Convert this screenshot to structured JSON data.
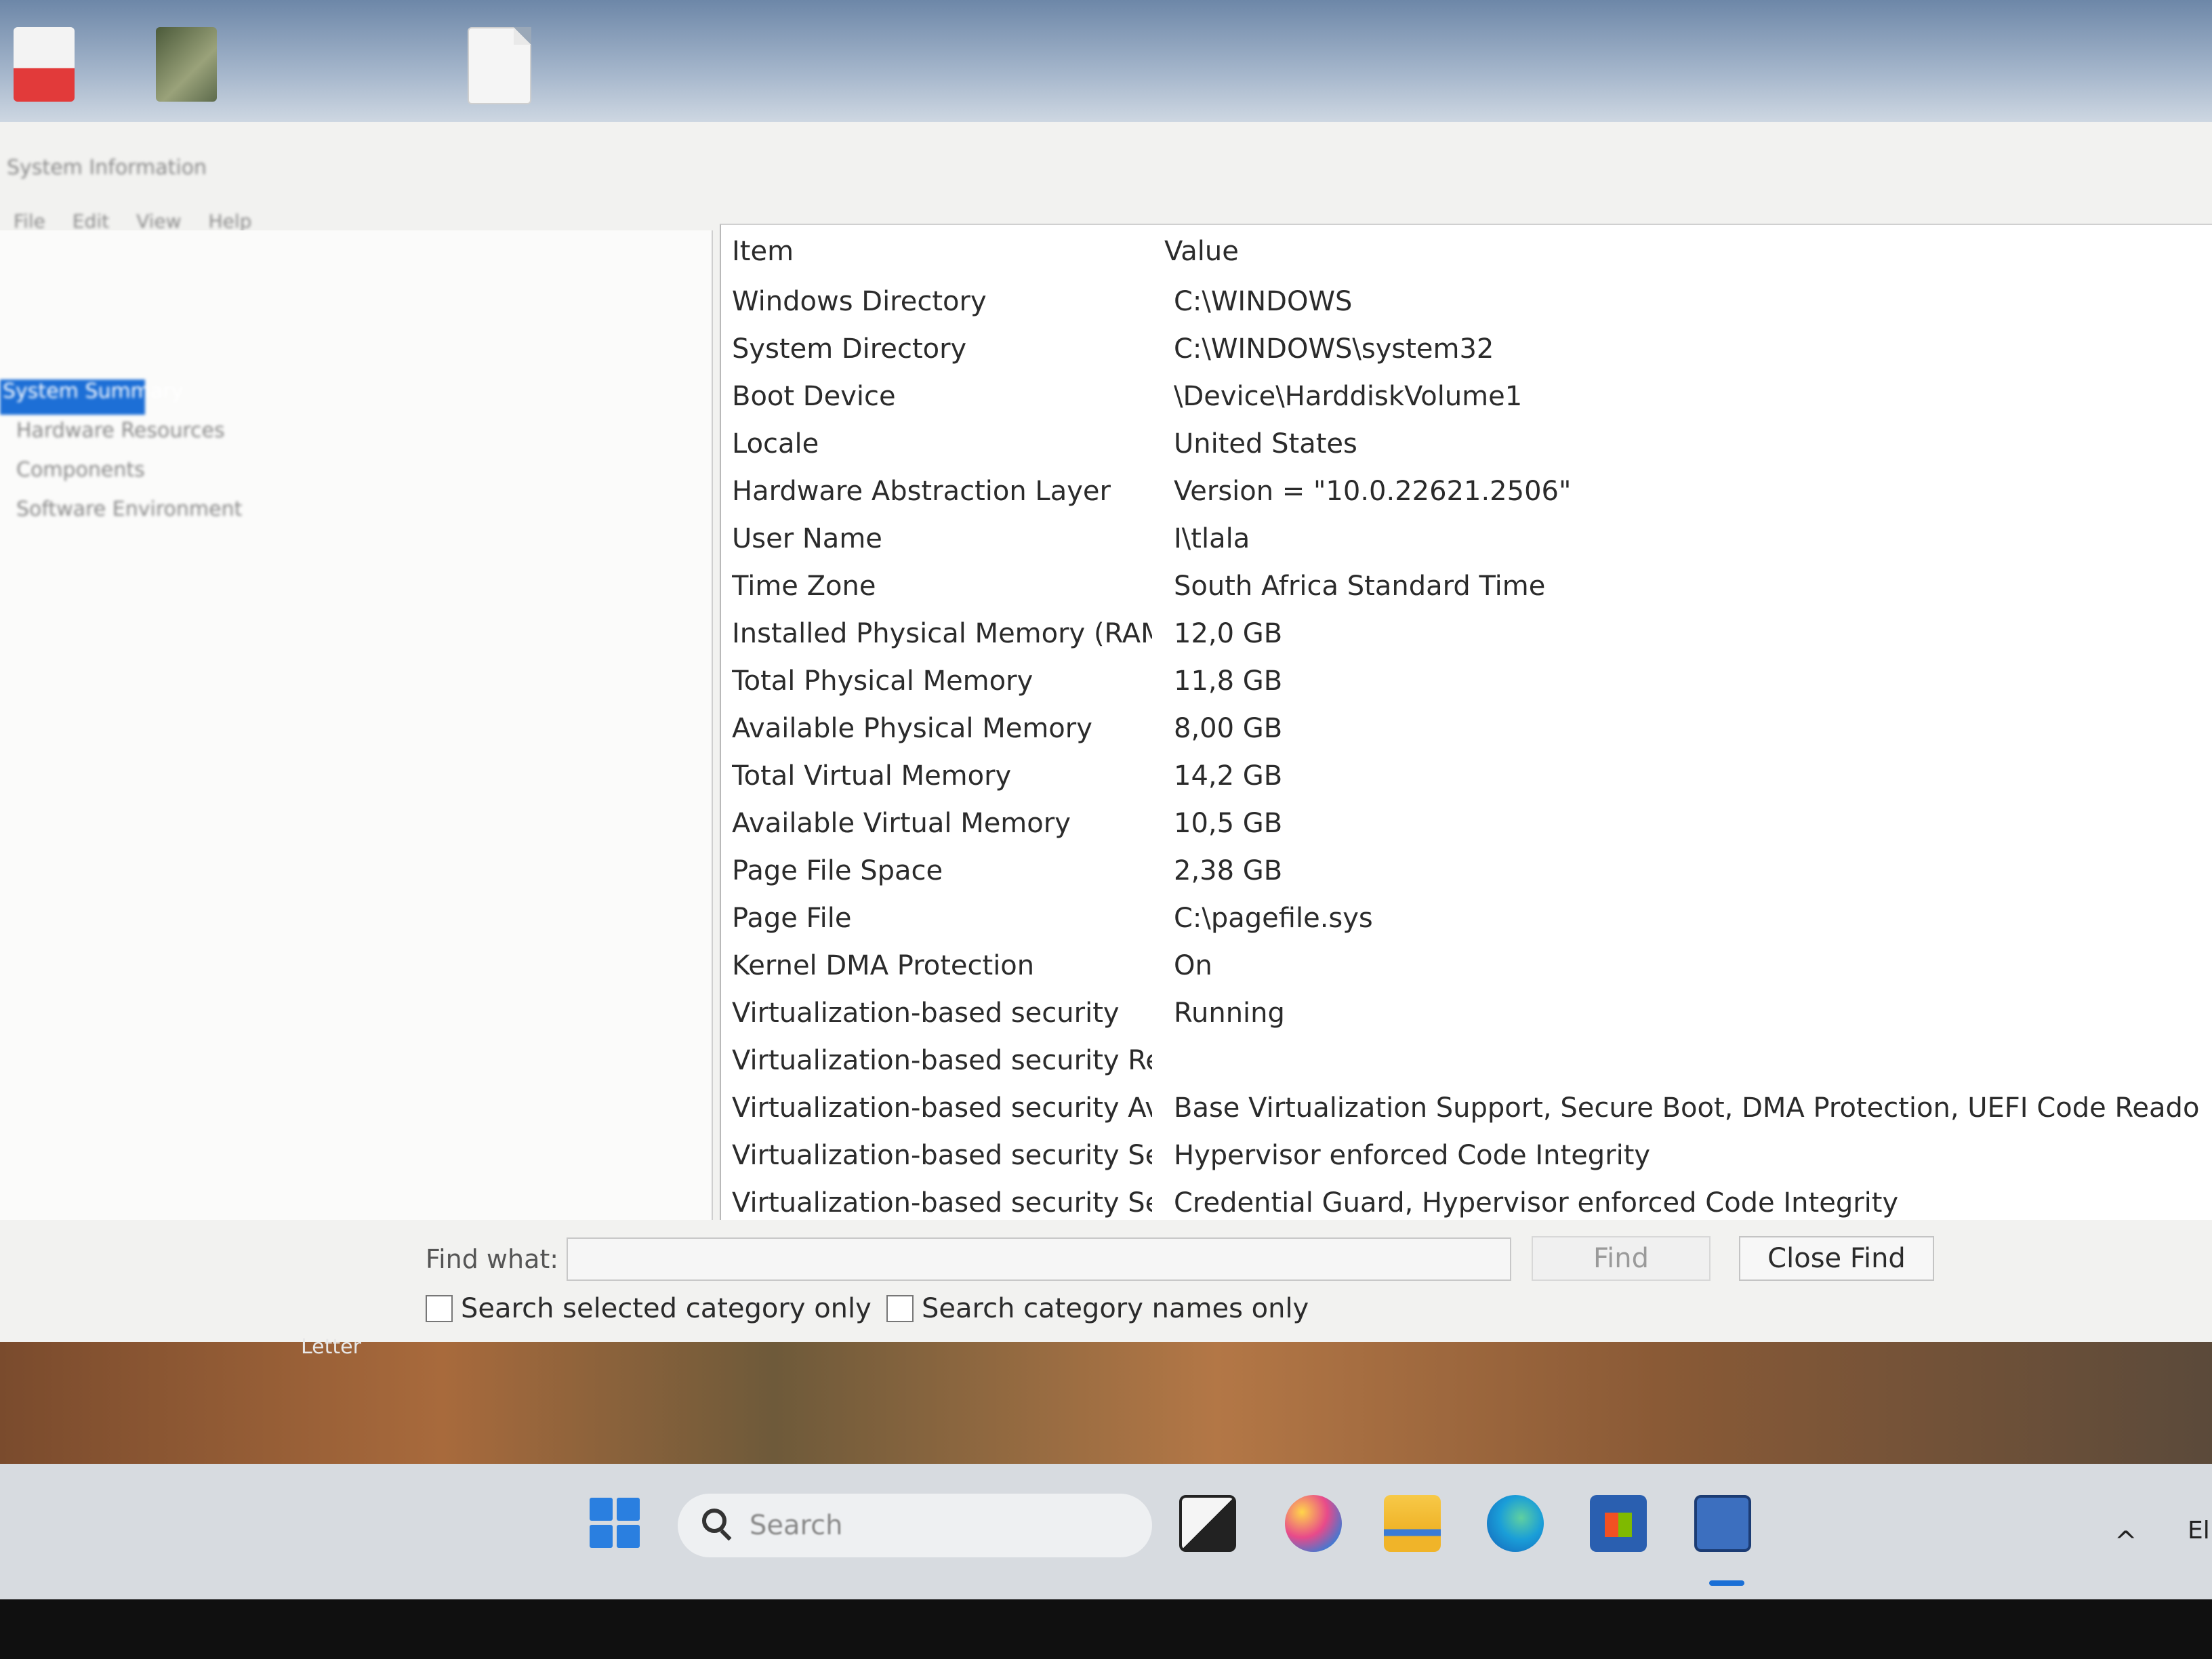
{
  "desktop": {
    "shortcut_label": "Letter"
  },
  "window": {
    "title": "System Information",
    "menu": [
      "File",
      "Edit",
      "View",
      "Help"
    ],
    "tree": [
      {
        "label": "System Summary",
        "selected": true
      },
      {
        "label": "Hardware Resources",
        "selected": false
      },
      {
        "label": "Components",
        "selected": false
      },
      {
        "label": "Software Environment",
        "selected": false
      }
    ],
    "columns": {
      "item": "Item",
      "value": "Value"
    },
    "rows": [
      {
        "item": "Windows Directory",
        "value": "C:\\WINDOWS"
      },
      {
        "item": "System Directory",
        "value": "C:\\WINDOWS\\system32"
      },
      {
        "item": "Boot Device",
        "value": "\\Device\\HarddiskVolume1"
      },
      {
        "item": "Locale",
        "value": "United States"
      },
      {
        "item": "Hardware Abstraction Layer",
        "value": "Version = \"10.0.22621.2506\""
      },
      {
        "item": "User Name",
        "value": "I\\tlala"
      },
      {
        "item": "Time Zone",
        "value": "South Africa Standard Time"
      },
      {
        "item": "Installed Physical Memory (RAM)",
        "value": "12,0 GB"
      },
      {
        "item": "Total Physical Memory",
        "value": "11,8 GB"
      },
      {
        "item": "Available Physical Memory",
        "value": "8,00 GB"
      },
      {
        "item": "Total Virtual Memory",
        "value": "14,2 GB"
      },
      {
        "item": "Available Virtual Memory",
        "value": "10,5 GB"
      },
      {
        "item": "Page File Space",
        "value": "2,38 GB"
      },
      {
        "item": "Page File",
        "value": "C:\\pagefile.sys"
      },
      {
        "item": "Kernel DMA Protection",
        "value": "On"
      },
      {
        "item": "Virtualization-based security",
        "value": "Running"
      },
      {
        "item": "Virtualization-based security Re...",
        "value": ""
      },
      {
        "item": "Virtualization-based security Av...",
        "value": "Base Virtualization Support, Secure Boot, DMA Protection, UEFI Code Reado"
      },
      {
        "item": "Virtualization-based security Se...",
        "value": "Hypervisor enforced Code Integrity"
      },
      {
        "item": "Virtualization-based security Se...",
        "value": "Credential Guard, Hypervisor enforced Code Integrity"
      }
    ],
    "find": {
      "label": "Find what:",
      "value": "",
      "find_button": "Find",
      "close_find_button": "Close Find",
      "option_selected_category": "Search selected category only",
      "option_category_names": "Search category names only"
    }
  },
  "taskbar": {
    "search_placeholder": "Search",
    "language": "El"
  },
  "colors": {
    "selection": "#1d6fd6",
    "window_bg": "#f2f2f0",
    "list_bg": "#ffffff"
  },
  "icons": [
    "start-icon",
    "search-icon",
    "task-view-icon",
    "copilot-icon",
    "file-explorer-icon",
    "edge-icon",
    "store-icon",
    "system-information-icon",
    "chevron-up-icon"
  ]
}
